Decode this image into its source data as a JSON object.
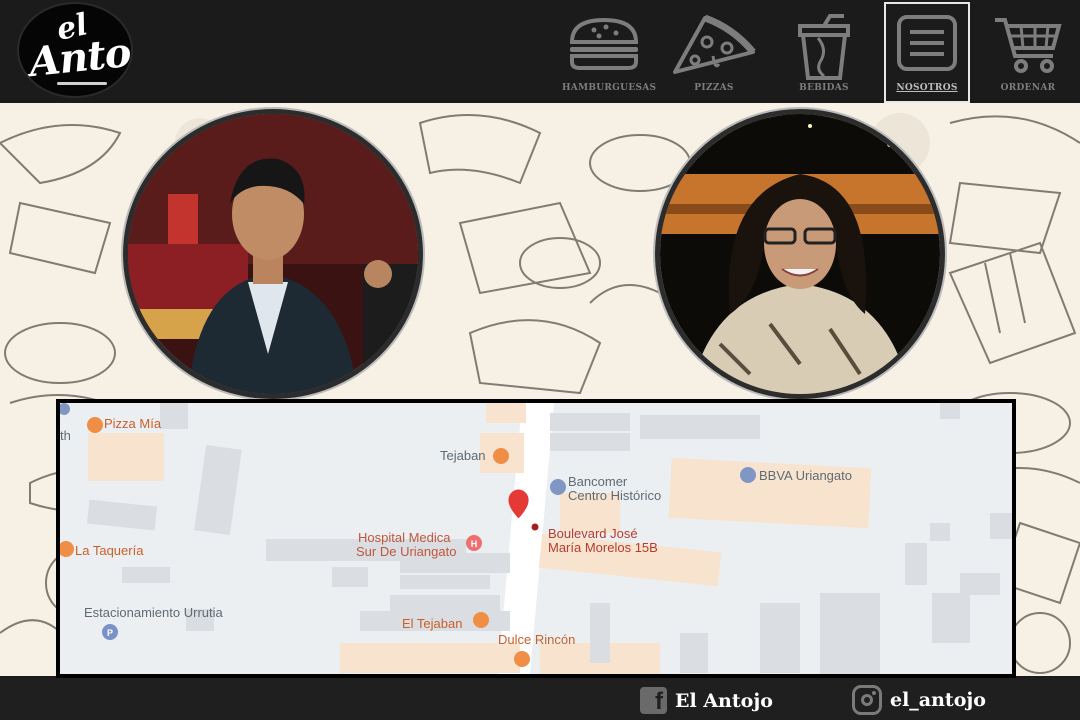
{
  "brand": {
    "logo_small": "el",
    "logo_name": "Antojo"
  },
  "nav": [
    {
      "label": "HAMBURGUESAS",
      "icon": "burger-icon"
    },
    {
      "label": "PIZZAS",
      "icon": "pizza-icon"
    },
    {
      "label": "BEBIDAS",
      "icon": "drink-icon"
    },
    {
      "label": "NOSOTROS",
      "icon": "menu-icon",
      "active": true
    },
    {
      "label": "ORDENAR",
      "icon": "cart-icon"
    }
  ],
  "map": {
    "places": {
      "pizza_mia": "Pizza Mía",
      "tejaban_top": "Tejaban",
      "bancomer_1": "Bancomer",
      "bancomer_2": "Centro Histórico",
      "bbva": "BBVA Uriangato",
      "hospital_1": "Hospital Medica",
      "hospital_2": "Sur De Uriangato",
      "pin_1": "Boulevard José",
      "pin_2": "María Morelos 15B",
      "taqueria": "La Taquería",
      "estacionamiento": "Estacionamiento Urrutia",
      "el_tejaban": "El Tejaban",
      "dulce_rincon": "Dulce Rincón",
      "edge_label": "th"
    }
  },
  "footer": {
    "facebook": "El Antojo",
    "instagram": "el_antojo"
  },
  "colors": {
    "header": "#1b1b1b",
    "background": "#f7f1e5",
    "map_pin": "#e53935",
    "place_orange": "#c9602a"
  }
}
